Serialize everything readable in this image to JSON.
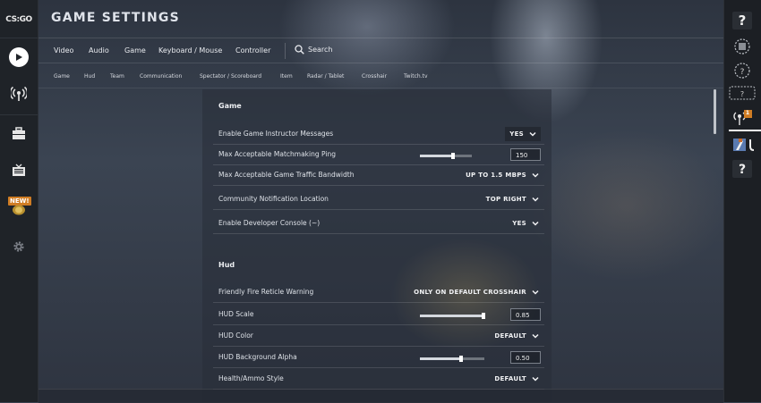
{
  "app": {
    "logo_text": "CS:GO",
    "page_title": "GAME SETTINGS",
    "new_badge": "NEW!"
  },
  "main_tabs": [
    "Video",
    "Audio",
    "Game",
    "Keyboard / Mouse",
    "Controller"
  ],
  "search_label": "Search",
  "sub_tabs": [
    "Game",
    "Hud",
    "Team",
    "Communication",
    "Spectator / Scoreboard",
    "Item",
    "Radar / Tablet",
    "Crosshair",
    "Twitch.tv"
  ],
  "sections": {
    "game": {
      "title": "Game",
      "rows": [
        {
          "label": "Enable Game Instructor Messages",
          "type": "dropdown",
          "value": "YES"
        },
        {
          "label": "Max Acceptable Matchmaking Ping",
          "type": "slider",
          "value": "150",
          "fraction": 0.62
        },
        {
          "label": "Max Acceptable Game Traffic Bandwidth",
          "type": "dropdown",
          "value": "UP TO 1.5 MBPS"
        },
        {
          "label": "Community Notification Location",
          "type": "dropdown",
          "value": "TOP RIGHT"
        },
        {
          "label": "Enable Developer Console (~)",
          "type": "dropdown",
          "value": "YES"
        }
      ]
    },
    "hud": {
      "title": "Hud",
      "rows": [
        {
          "label": "Friendly Fire Reticle Warning",
          "type": "dropdown",
          "value": "ONLY ON DEFAULT CROSSHAIR"
        },
        {
          "label": "HUD Scale",
          "type": "slider",
          "value": "0.85",
          "fraction": 0.85
        },
        {
          "label": "HUD Color",
          "type": "dropdown",
          "value": "DEFAULT"
        },
        {
          "label": "HUD Background Alpha",
          "type": "slider",
          "value": "0.50",
          "fraction": 0.5
        },
        {
          "label": "Health/Ammo Style",
          "type": "dropdown",
          "value": "DEFAULT"
        }
      ]
    }
  },
  "right_rail": {
    "notification_count": "1"
  },
  "colors": {
    "accent_orange": "#d07d24",
    "rail_bg": "#1f2328"
  }
}
